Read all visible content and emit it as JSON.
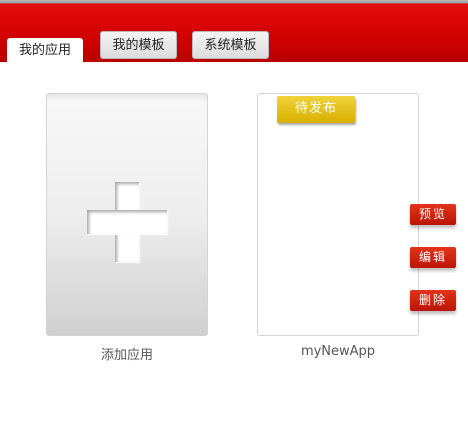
{
  "tabs": {
    "my_apps": "我的应用",
    "my_templates": "我的模板",
    "system_templates": "系统模板"
  },
  "add_card": {
    "icon": "plus-icon",
    "label": "添加应用"
  },
  "app_card": {
    "status": "待发布",
    "name": "myNewApp",
    "actions": {
      "preview": "预览",
      "edit": "编辑",
      "delete": "删除"
    }
  },
  "colors": {
    "header_red": "#d00000",
    "status_yellow": "#e2c01a",
    "action_red": "#d42410"
  }
}
